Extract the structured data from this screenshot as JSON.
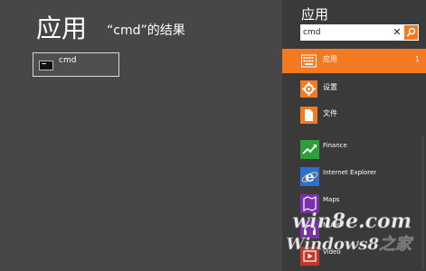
{
  "results": {
    "title": "应用",
    "subtitle": "“cmd”的结果",
    "items": [
      {
        "label": "cmd",
        "icon": "command-prompt-icon"
      }
    ]
  },
  "charm": {
    "title": "应用",
    "search": {
      "value": "cmd",
      "clear_glyph": "✕",
      "button_icon": "search-icon"
    },
    "scopes": [
      {
        "label": "应用",
        "count": "1",
        "icon": "apps-keyboard-icon",
        "active": true
      },
      {
        "label": "设置",
        "count": "",
        "icon": "gear-icon",
        "active": false
      },
      {
        "label": "文件",
        "count": "",
        "icon": "file-icon",
        "active": false
      }
    ],
    "apps": [
      {
        "label": "Finance",
        "icon": "finance-icon",
        "color": "#2e9e3a"
      },
      {
        "label": "Internet Explorer",
        "icon": "internet-explorer-icon",
        "color": "#2a6fd6"
      },
      {
        "label": "Maps",
        "icon": "maps-icon",
        "color": "#7b2fa8"
      },
      {
        "label": "Music",
        "icon": "music-icon",
        "color": "#7b2fa8"
      },
      {
        "label": "Video",
        "icon": "video-icon",
        "color": "#c0392b"
      }
    ]
  },
  "watermark": {
    "line1": "win8e.com",
    "line2": "Windows8之家"
  },
  "colors": {
    "accent": "#f47a22",
    "background": "#484848",
    "charm_background": "#3a3a3a"
  }
}
